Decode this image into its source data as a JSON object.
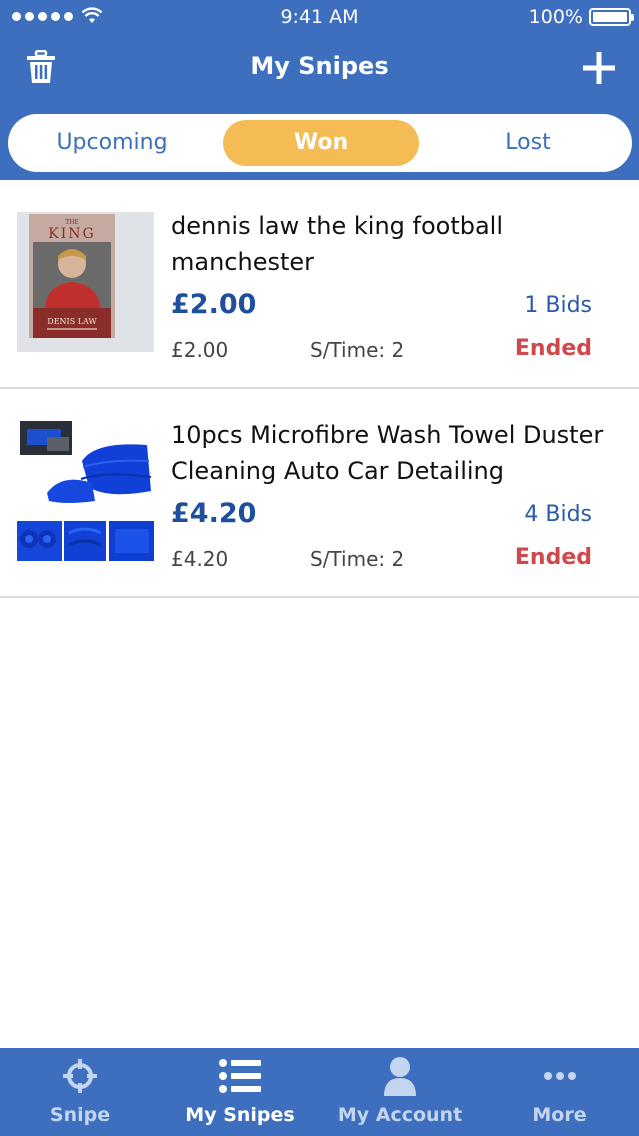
{
  "status_bar": {
    "time": "9:41 AM",
    "battery": "100%"
  },
  "nav": {
    "title": "My Snipes"
  },
  "segments": {
    "upcoming": "Upcoming",
    "won": "Won",
    "lost": "Lost"
  },
  "items": [
    {
      "title": "dennis law the king football manchester",
      "price": "£2.00",
      "bids": "1 Bids",
      "price_small": "£2.00",
      "stime": "S/Time: 2",
      "status": "Ended",
      "book_title": "KING",
      "book_title_small": "THE",
      "book_author": "DENIS LAW"
    },
    {
      "title": "10pcs Microfibre Wash Towel Duster Cleaning Auto Car Detailing",
      "price": "£4.20",
      "bids": "4 Bids",
      "price_small": "£4.20",
      "stime": "S/Time: 2",
      "status": "Ended"
    }
  ],
  "tabbar": {
    "snipe": "Snipe",
    "my_snipes": "My Snipes",
    "my_account": "My Account",
    "more": "More"
  },
  "colors": {
    "header_blue": "#3d6fbe",
    "segment_selected": "#f5bc55",
    "price_blue": "#1f4f9c",
    "ended_red": "#d0484b"
  },
  "icons": {
    "left_nav": "trash-icon",
    "right_nav": "plus-icon",
    "tab_snipe": "crosshair-icon",
    "tab_my_snipes": "list-icon",
    "tab_my_account": "person-icon",
    "tab_more": "ellipsis-icon"
  }
}
